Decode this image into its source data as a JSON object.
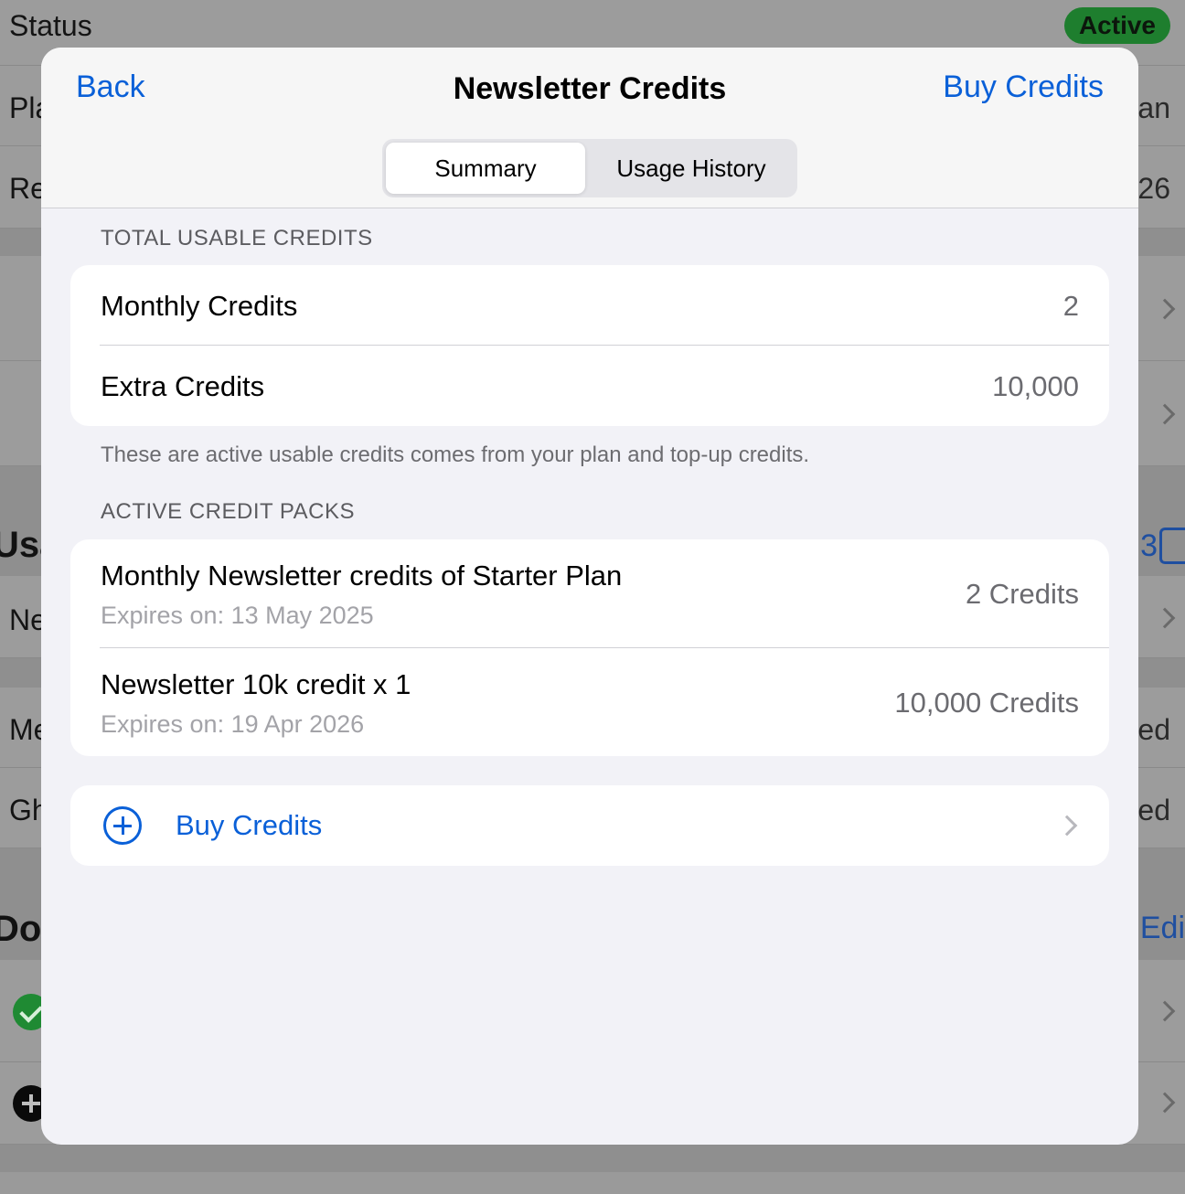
{
  "background": {
    "status_label": "Status",
    "status_badge": "Active",
    "row_labels": [
      "Pla",
      "Re",
      "Ne",
      "Me",
      "Gh"
    ],
    "row_values": [
      "an",
      "26",
      "ed",
      "ed"
    ],
    "section_usage": "Usa",
    "section_domains": "Dor",
    "usage_right": "3",
    "edit_label": "Edi"
  },
  "nav": {
    "back_label": "Back",
    "title": "Newsletter Credits",
    "buy_label": "Buy Credits"
  },
  "tabs": [
    {
      "label": "Summary",
      "selected": true
    },
    {
      "label": "Usage History",
      "selected": false
    }
  ],
  "total": {
    "header": "TOTAL USABLE CREDITS",
    "rows": [
      {
        "label": "Monthly Credits",
        "value": "2"
      },
      {
        "label": "Extra Credits",
        "value": "10,000"
      }
    ],
    "footnote": "These are active usable credits comes from your plan and top-up credits."
  },
  "packs": {
    "header": "ACTIVE CREDIT PACKS",
    "items": [
      {
        "title": "Monthly Newsletter credits of Starter Plan",
        "expires": "Expires on: 13 May 2025",
        "credits": "2 Credits"
      },
      {
        "title": "Newsletter 10k credit x 1",
        "expires": "Expires on: 19 Apr 2026",
        "credits": "10,000 Credits"
      }
    ]
  },
  "buy_cell": {
    "label": "Buy Credits"
  },
  "colors": {
    "accent": "#0a60d8",
    "sheet_bg": "#f2f2f7",
    "status_green": "#1e7e2e"
  }
}
